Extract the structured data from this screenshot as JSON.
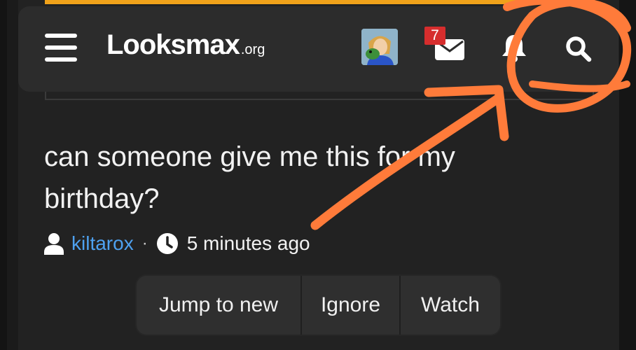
{
  "site": {
    "logo_text": "Looksmax",
    "logo_tld": ".org"
  },
  "header": {
    "inbox_badge": "7"
  },
  "thread": {
    "title": "can someone give me this for my birthday?",
    "author": "kiltarox",
    "separator": "·",
    "time_ago": "5 minutes ago"
  },
  "actions": {
    "jump_label": "Jump to new",
    "ignore_label": "Ignore",
    "watch_label": "Watch"
  },
  "colors": {
    "accent": "#f0a21a",
    "link": "#4ea1f0",
    "badge": "#d62d2d",
    "annotation": "#ff7b3a"
  },
  "icons": [
    "menu-icon",
    "avatar",
    "envelope-icon",
    "bell-icon",
    "search-icon",
    "user-icon",
    "clock-icon"
  ]
}
